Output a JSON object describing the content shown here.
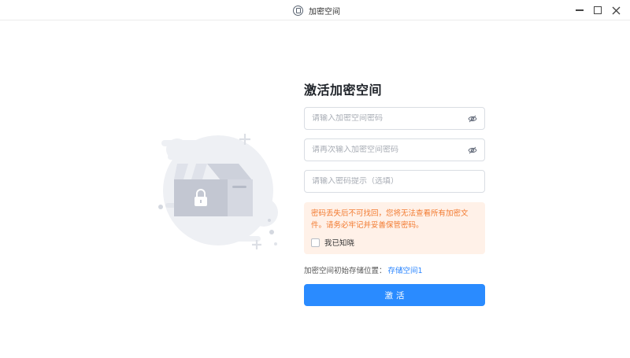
{
  "window": {
    "title": "加密空间",
    "icon": "lock-safe-icon"
  },
  "illustration": {
    "icon": "locked-box-icon"
  },
  "form": {
    "heading": "激活加密空间",
    "password_placeholder": "请输入加密空间密码",
    "confirm_placeholder": "请再次输入加密空间密码",
    "hint_placeholder": "请输入密码提示（选填）",
    "warning": "密码丢失后不可找回，您将无法查看所有加密文件。请务必牢记并妥善保管密码。",
    "acknowledge_label": "我已知晓",
    "acknowledged": false,
    "location_label": "加密空间初始存储位置：",
    "location_value": "存储空间1",
    "activate_label": "激活"
  },
  "colors": {
    "accent": "#2a8bff",
    "link": "#2a85ff",
    "warning_text": "#f27a30",
    "warning_bg": "#fff1e8"
  }
}
